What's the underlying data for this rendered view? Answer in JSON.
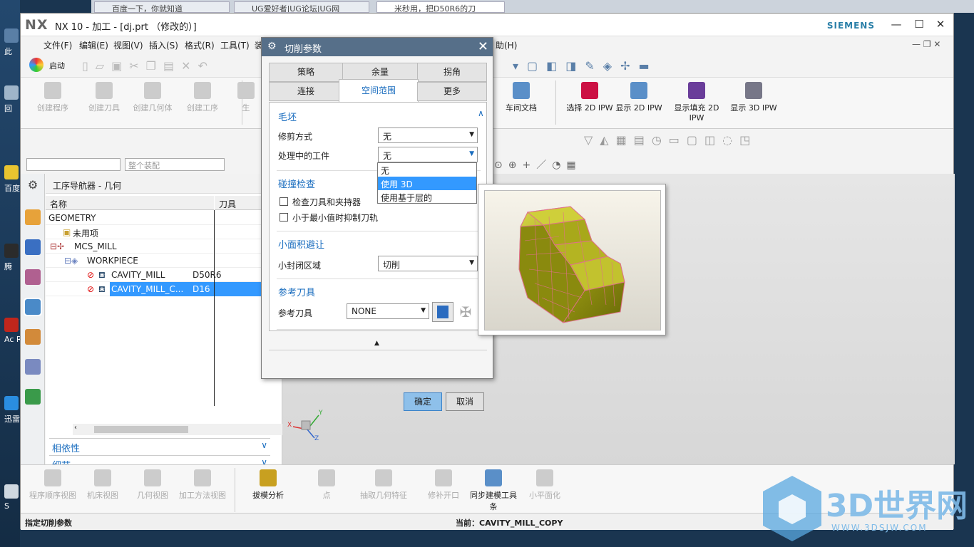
{
  "desktop": {
    "icons": [
      "此",
      "回",
      "百度",
      "腾",
      "Ac Rea",
      "迅雷",
      "S"
    ]
  },
  "browser": {
    "tabs": [
      "百度一下，你就知道",
      "UG爱好者|UG论坛|UG网",
      "米秒用，把D50R6的刀"
    ]
  },
  "window": {
    "logo": "NX",
    "title": "NX 10 - 加工 - [dj.prt （修改的）]",
    "brand": "SIEMENS",
    "controls": {
      "min": "—",
      "max": "☐",
      "close": "✕"
    }
  },
  "menu": [
    "文件(F)",
    "编辑(E)",
    "视图(V)",
    "插入(S)",
    "格式(R)",
    "工具(T)",
    "装",
    "助(H)"
  ],
  "toolbar": {
    "start_label": "启动"
  },
  "ribbon": {
    "left": [
      "创建程序",
      "创建刀具",
      "创建几何体",
      "创建工序",
      "生"
    ],
    "right": [
      "车间文档",
      "选择 2D IPW",
      "显示 2D IPW",
      "显示填充 2D IPW",
      "显示 3D IPW"
    ]
  },
  "selection": {
    "filter_value": "",
    "scope_placeholder": "整个装配"
  },
  "navigator": {
    "title": "工序导航器 - 几何",
    "col_name": "名称",
    "col_tool": "刀具",
    "rows": [
      {
        "name": "GEOMETRY",
        "tool": ""
      },
      {
        "name": "未用项",
        "tool": ""
      },
      {
        "name": "MCS_MILL",
        "tool": ""
      },
      {
        "name": "WORKPIECE",
        "tool": ""
      },
      {
        "name": "CAVITY_MILL",
        "tool": "D50R6"
      },
      {
        "name": "CAVITY_MILL_C...",
        "tool": "D16"
      }
    ],
    "dependency": "相依性",
    "details": "细节"
  },
  "dialog": {
    "title": "切削参数",
    "close": "✕",
    "tabs_row1": [
      "策略",
      "余量",
      "拐角"
    ],
    "tabs_row2": [
      "连接",
      "空间范围",
      "更多"
    ],
    "blank": {
      "header": "毛坯",
      "trim_label": "修剪方式",
      "trim_value": "无",
      "ipw_label": "处理中的工件",
      "ipw_value": "无"
    },
    "collision": {
      "header": "碰撞检查",
      "check_holder": "检查刀具和夹持器",
      "suppress_min": "小于最小值时抑制刀轨"
    },
    "small_area": {
      "header": "小面积避让",
      "label": "小封闭区域",
      "value": "切削"
    },
    "ref_tool": {
      "header": "参考刀具",
      "label": "参考刀具",
      "value": "NONE"
    },
    "ok": "确定",
    "cancel": "取消",
    "dropdown_options": [
      "无",
      "使用 3D",
      "使用基于层的"
    ],
    "selected_option": "使用 3D"
  },
  "bottom": {
    "left": [
      "程序顺序视图",
      "机床视图",
      "几何视图",
      "加工方法视图"
    ],
    "right": [
      "拔模分析",
      "点",
      "抽取几何特征",
      "修补开口",
      "同步建模工具条",
      "小平面化"
    ]
  },
  "status": {
    "left": "指定切削参数",
    "current": "当前：CAVITY_MILL_COPY"
  },
  "axes": {
    "x": "X",
    "y": "Y",
    "z": "Z"
  },
  "watermark": {
    "main": "3D世界网",
    "url": "WWW.3DSJW.COM"
  },
  "colors": {
    "accent": "#1a6dbf",
    "selection": "#3399ff",
    "dialog_title": "#566f89",
    "part": "#b5b511"
  }
}
